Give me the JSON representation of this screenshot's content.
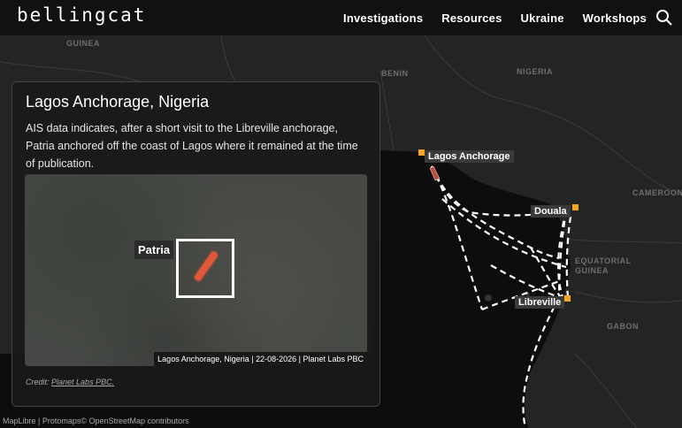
{
  "header": {
    "logo": "bellingcat",
    "nav": [
      "Investigations",
      "Resources",
      "Ukraine",
      "Workshops"
    ]
  },
  "map": {
    "countries": [
      "GUINEA",
      "BENIN",
      "NIGERIA",
      "CAMEROON",
      "EQUATORIAL GUINEA",
      "GABON"
    ],
    "places": {
      "lagos": "Lagos Anchorage",
      "douala": "Douala",
      "libreville": "Libreville"
    },
    "attribution": "MapLibre | Protomaps© OpenStreetMap contributors",
    "colors": {
      "marker": "#f5a623",
      "route": "#ffffff",
      "land": "#242424",
      "sea": "#0d0d0d"
    }
  },
  "panel": {
    "title": "Lagos Anchorage, Nigeria",
    "text": "AIS data indicates, after a short visit to the Libreville anchorage, Patria anchored off the coast of Lagos where it remained at the time of publication.",
    "image": {
      "ship_label": "Patria",
      "caption": "Lagos Anchorage, Nigeria | 22-08-2026 | Planet Labs PBC"
    },
    "credit_prefix": "Credit:",
    "credit_link": "Planet Labs PBC."
  }
}
